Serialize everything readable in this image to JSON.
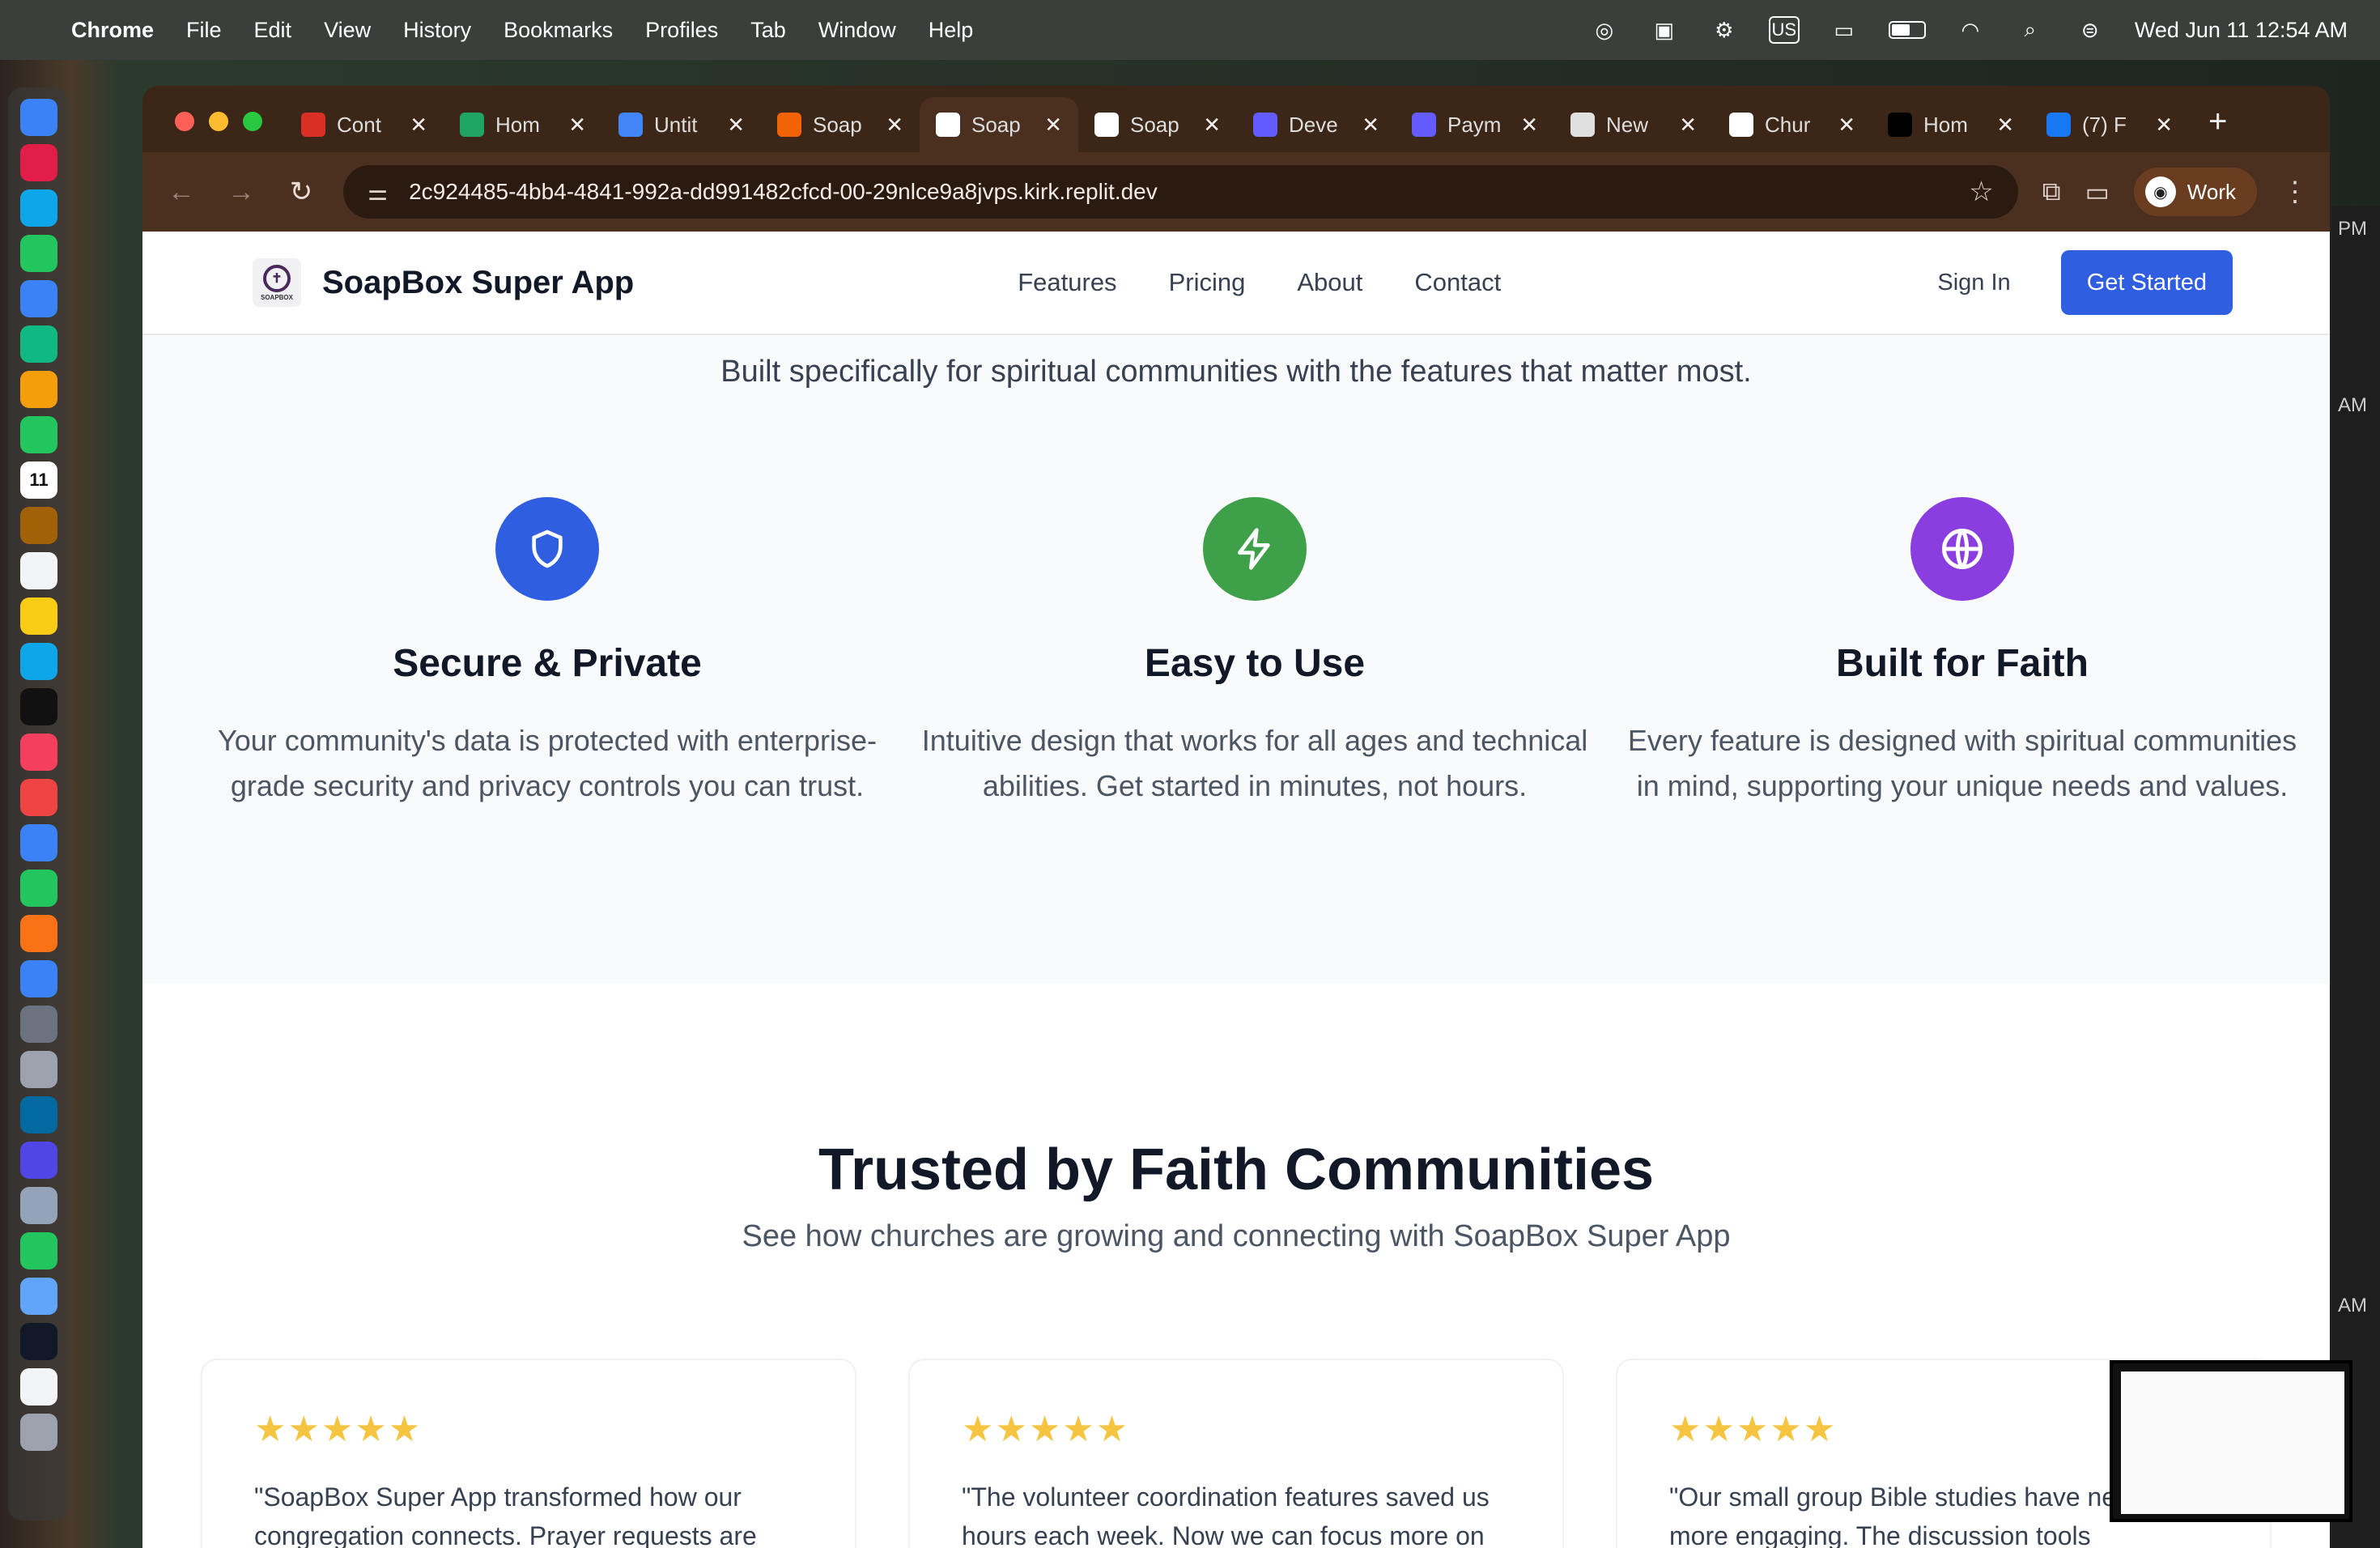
{
  "menubar": {
    "app": "Chrome",
    "items": [
      "File",
      "Edit",
      "View",
      "History",
      "Bookmarks",
      "Profiles",
      "Tab",
      "Window",
      "Help"
    ],
    "keyboard": "US",
    "datetime": "Wed Jun 11  12:54 AM"
  },
  "dock": {
    "apps": [
      "finder",
      "launchpad",
      "safari",
      "messages",
      "mail",
      "maps",
      "photos",
      "facetime",
      "calendar",
      "contacts",
      "reminders",
      "notes",
      "freeform",
      "tv",
      "music",
      "news",
      "keynote",
      "numbers",
      "pages",
      "app-store",
      "system-settings",
      "preview",
      "outlook",
      "teams",
      "remote-desktop",
      "chrome",
      "finder-2",
      "terminal",
      "textedit",
      "trash"
    ],
    "calendar_day": "11"
  },
  "right_window": {
    "labels": [
      "PM",
      "AM",
      "AM"
    ]
  },
  "tabs": [
    {
      "title": "Cont",
      "favicon": "gmail",
      "color": "#d93025",
      "active": false
    },
    {
      "title": "Hom",
      "favicon": "drive",
      "color": "#1fa463",
      "active": false
    },
    {
      "title": "Untit",
      "favicon": "docs",
      "color": "#4285f4",
      "active": false
    },
    {
      "title": "Soap",
      "favicon": "replit",
      "color": "#f26207",
      "active": false
    },
    {
      "title": "Soap",
      "favicon": "soapbox",
      "color": "#ffffff",
      "active": true
    },
    {
      "title": "Soap",
      "favicon": "soapbox",
      "color": "#ffffff",
      "active": false
    },
    {
      "title": "Deve",
      "favicon": "stripe",
      "color": "#635bff",
      "active": false
    },
    {
      "title": "Paym",
      "favicon": "stripe",
      "color": "#635bff",
      "active": false
    },
    {
      "title": "New",
      "favicon": "chrome",
      "color": "#e0e0e0",
      "active": false
    },
    {
      "title": "Chur",
      "favicon": "openai",
      "color": "#ffffff",
      "active": false
    },
    {
      "title": "Hom",
      "favicon": "x",
      "color": "#000000",
      "active": false
    },
    {
      "title": "(7) F",
      "favicon": "facebook",
      "color": "#1877f2",
      "active": false
    }
  ],
  "address": "2c924485-4bb4-4841-992a-dd991482cfcd-00-29nlce9a8jvps.kirk.replit.dev",
  "profile_label": "Work",
  "site": {
    "brand": "SoapBox Super App",
    "logo_text": "SOAPBOX",
    "nav": [
      "Features",
      "Pricing",
      "About",
      "Contact"
    ],
    "signin": "Sign In",
    "cta": "Get Started"
  },
  "features": {
    "subtitle": "Built specifically for spiritual communities with the features that matter most.",
    "items": [
      {
        "icon": "shield-icon",
        "color": "#2f5fe0",
        "title": "Secure & Private",
        "text": "Your community's data is protected with enterprise-grade security and privacy controls you can trust."
      },
      {
        "icon": "lightning-icon",
        "color": "#3fa04a",
        "title": "Easy to Use",
        "text": "Intuitive design that works for all ages and technical abilities. Get started in minutes, not hours."
      },
      {
        "icon": "globe-icon",
        "color": "#8a3ee0",
        "title": "Built for Faith",
        "text": "Every feature is designed with spiritual communities in mind, supporting your unique needs and values."
      }
    ]
  },
  "testimonials": {
    "title": "Trusted by Faith Communities",
    "subtitle": "See how churches are growing and connecting with SoapBox Super App",
    "cards": [
      {
        "rating": 5,
        "stars": "★★★★★",
        "quote": "\"SoapBox Super App transformed how our congregation connects. Prayer requests are"
      },
      {
        "rating": 5,
        "stars": "★★★★★",
        "quote": "\"The volunteer coordination features saved us hours each week. Now we can focus more on"
      },
      {
        "rating": 5,
        "stars": "★★★★★",
        "quote": "\"Our small group Bible studies have never been more engaging. The discussion tools"
      }
    ]
  }
}
